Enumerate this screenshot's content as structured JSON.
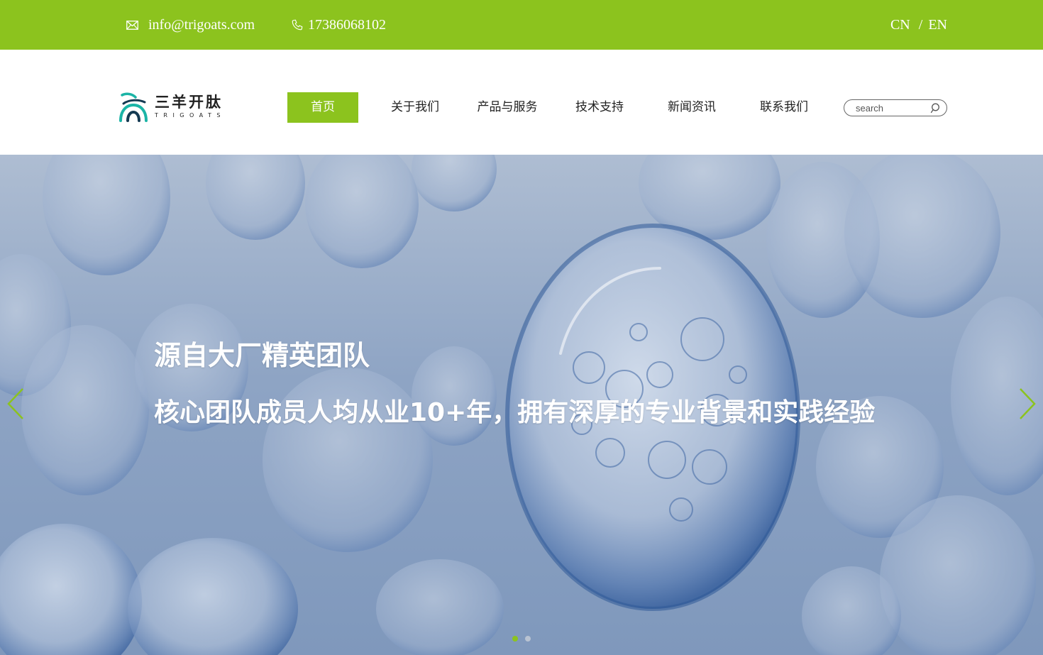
{
  "topbar": {
    "email": "info@trigoats.com",
    "phone": "17386068102",
    "lang_cn": "CN",
    "lang_sep": "/",
    "lang_en": "EN",
    "email_icon": "envelope-icon",
    "phone_icon": "phone-icon",
    "bg_color": "#8cc31e"
  },
  "logo": {
    "cn": "三羊开肽",
    "en": "TRIGOATS"
  },
  "nav": {
    "items": [
      {
        "label": "首页",
        "active": true
      },
      {
        "label": "关于我们"
      },
      {
        "label": "产品与服务"
      },
      {
        "label": "技术支持"
      },
      {
        "label": "新闻资讯"
      },
      {
        "label": "联系我们"
      }
    ],
    "active_color": "#8cc31e"
  },
  "search": {
    "placeholder": "search",
    "icon": "search-icon"
  },
  "banner": {
    "headline": "源自大厂精英团队",
    "subline": "核心团队成员人均从业10+年，拥有深厚的专业背景和实践经验",
    "prev_icon": "chevron-left-icon",
    "next_icon": "chevron-right-icon",
    "slides_total": 2,
    "slide_active": 1
  }
}
